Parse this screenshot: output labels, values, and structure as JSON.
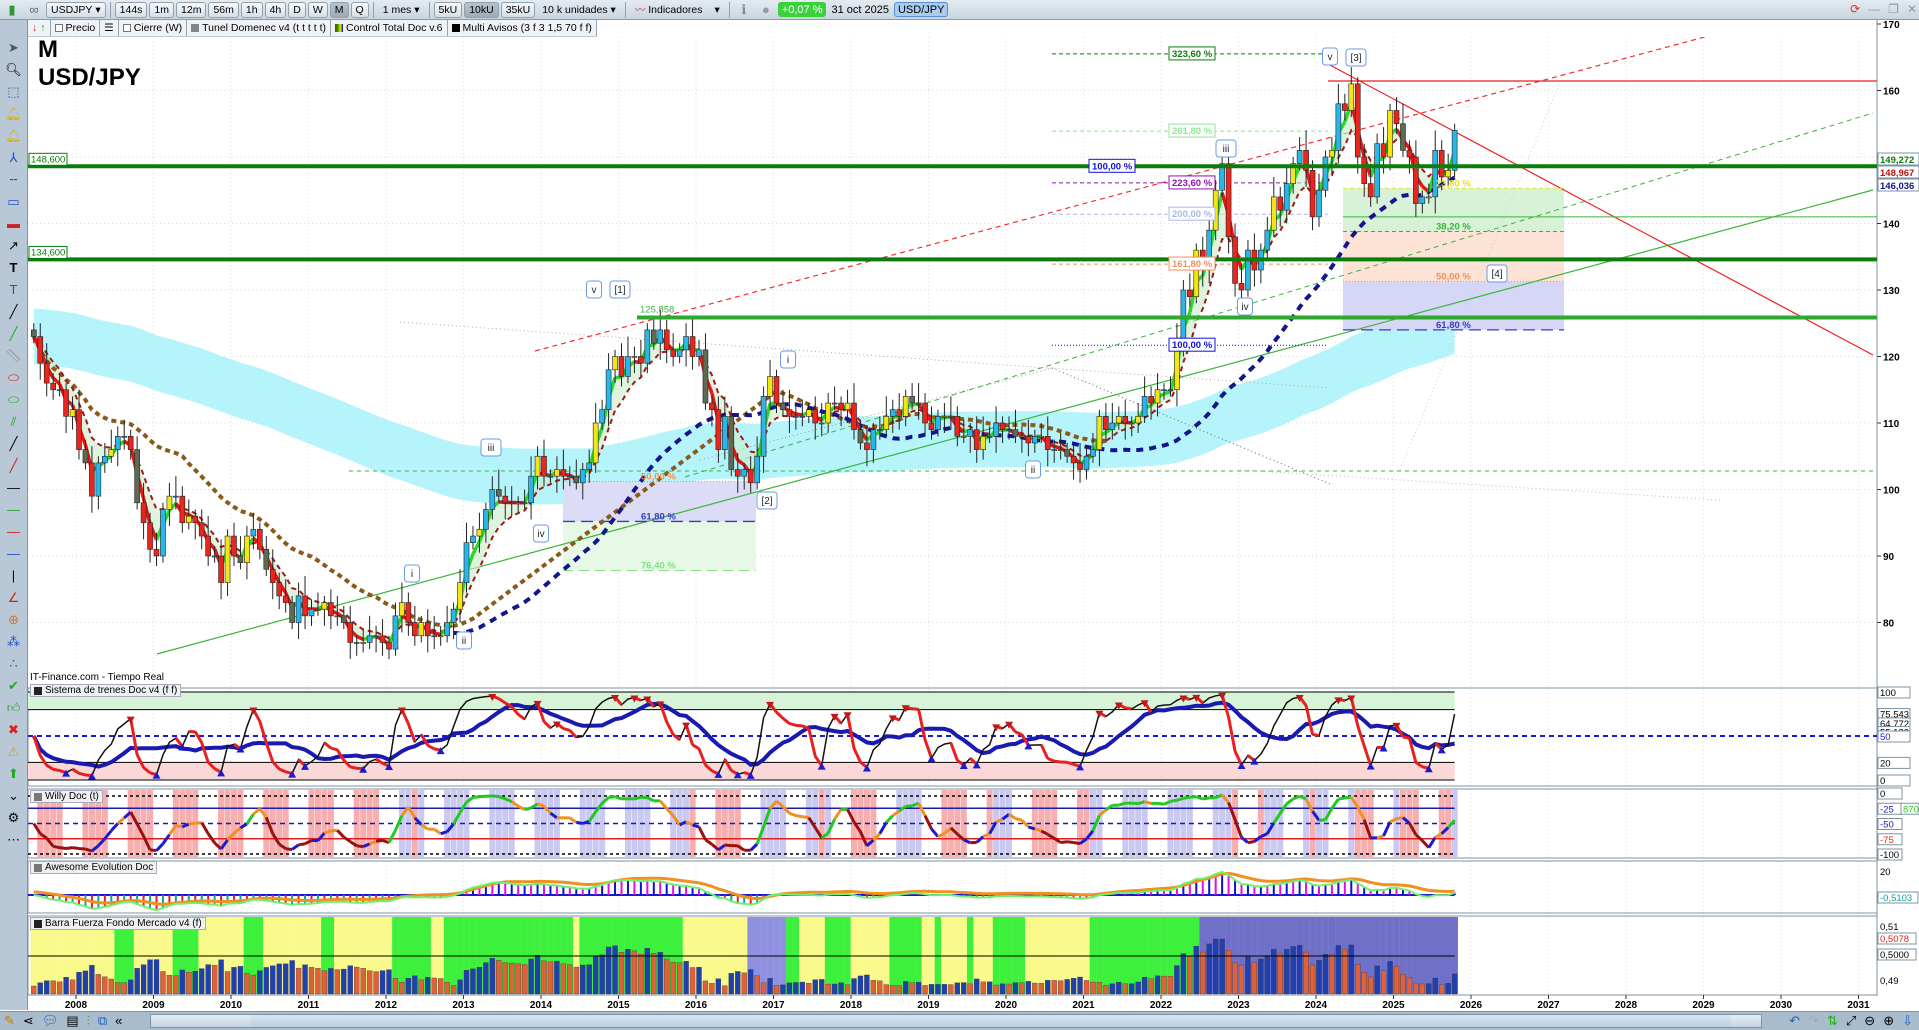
{
  "toolbar": {
    "symbol": "USDJPY",
    "timeframes": [
      "144s",
      "1m",
      "12m",
      "56m",
      "1h",
      "4h",
      "D",
      "W",
      "M",
      "Q"
    ],
    "active_timeframe": "M",
    "period": "1 mes",
    "units": [
      "5kU",
      "10kU",
      "35kU"
    ],
    "active_unit": "10kU",
    "units_select": "10 k unidades",
    "indicators_label": "Indicadores",
    "change": "+0,07 %",
    "date": "31 oct 2025",
    "pair_badge": "USD/JPY"
  },
  "legend": {
    "price": "Precio",
    "close": "Cierre (W)",
    "tunel": "Tunel Domenec v4 (t t t t t)",
    "control": "Control Total Doc v.6",
    "avisos": "Multi Avisos (3 f 3 1,5 70 f f)"
  },
  "chart_title": {
    "period": "M",
    "pair": "USD/JPY"
  },
  "source": "IT-Finance.com - Tiempo Real",
  "panes": {
    "p1": "Sistema de trenes Doc v4 (f f)",
    "p2": "Willy Doc (t)",
    "p3": "Awesome Evolution Doc",
    "p4": "Barra Fuerza Fondo Mercado v4 (f)"
  },
  "colors": {
    "up_a": "#29b6e8",
    "up_b": "#f5e60f",
    "down_a": "#e8261e",
    "down_b": "#5d6b55",
    "support": "#0a7d0a",
    "resistance": "#e81e1e",
    "navy": "#14148c"
  },
  "chart_data": {
    "type": "candlestick",
    "start": "2007-06",
    "closes": [
      123,
      119,
      116,
      115,
      115,
      111,
      112,
      106,
      104,
      99,
      104,
      105,
      106,
      108,
      108,
      106,
      98,
      95,
      91,
      90,
      97,
      99,
      99,
      95,
      96,
      95,
      93,
      90,
      90,
      86,
      93,
      90,
      89,
      93,
      94,
      91,
      88,
      86,
      84,
      83,
      80,
      84,
      81,
      82,
      82,
      83,
      81,
      81,
      80,
      77,
      77,
      77,
      78,
      78,
      77,
      76,
      81,
      83,
      80,
      78,
      80,
      78,
      78,
      78,
      80,
      82,
      86,
      92,
      93,
      94,
      97,
      100,
      99,
      98,
      98,
      98,
      98,
      102,
      105,
      102,
      102,
      103,
      102,
      102,
      101,
      103,
      104,
      110,
      112,
      118,
      120,
      117,
      120,
      120,
      119,
      124,
      122,
      124,
      121,
      120,
      121,
      123,
      120,
      121,
      113,
      112,
      106,
      111,
      103,
      102,
      103,
      101,
      105,
      114,
      117,
      113,
      112,
      111,
      111,
      111,
      112,
      110,
      110,
      113,
      113,
      112,
      113,
      109,
      107,
      106,
      109,
      109,
      111,
      112,
      111,
      114,
      113,
      113,
      110,
      109,
      111,
      111,
      111,
      108,
      108,
      109,
      106,
      108,
      108,
      110,
      109,
      109,
      108,
      108,
      107,
      108,
      108,
      106,
      106,
      106,
      105,
      104,
      103,
      105,
      106,
      111,
      109,
      110,
      111,
      110,
      110,
      111,
      114,
      113,
      115,
      115,
      115,
      122,
      130,
      129,
      136,
      133,
      139,
      145,
      149,
      138,
      131,
      130,
      136,
      133,
      136,
      139,
      144,
      142,
      146,
      149,
      151,
      148,
      141,
      145,
      150,
      151,
      158,
      157,
      161,
      150,
      146,
      144,
      152,
      150,
      157,
      155,
      151,
      150,
      143,
      144,
      144,
      151,
      147,
      148,
      154
    ],
    "years": [
      "2008",
      "2009",
      "2010",
      "2011",
      "2012",
      "2013",
      "2014",
      "2015",
      "2016",
      "2017",
      "2018",
      "2019",
      "2020",
      "2021",
      "2022",
      "2023",
      "2024",
      "2025",
      "2026",
      "2027",
      "2028",
      "2029",
      "2030",
      "2031"
    ],
    "price_ticks": [
      "170",
      "160",
      "150",
      "140",
      "130",
      "120",
      "110",
      "100",
      "90",
      "80"
    ],
    "price_tick_values": [
      170,
      160,
      150,
      140,
      130,
      120,
      110,
      100,
      90,
      80
    ],
    "levels": [
      {
        "label": "148,600",
        "price": 148.6
      },
      {
        "label": "134,600",
        "price": 134.6
      },
      {
        "label": "125,858",
        "price": 125.858
      }
    ],
    "last_values": [
      {
        "label": "149,272",
        "color": "#0a7d0a"
      },
      {
        "label": "148,967",
        "color": "#c01010"
      },
      {
        "label": "146,036",
        "color": "#14148c"
      }
    ],
    "fib_labels": [
      {
        "label": "323,60 %",
        "price": 165.5,
        "color": "#0a7d0a"
      },
      {
        "label": "261,80 %",
        "price": 153.9,
        "color": "#8ee88e"
      },
      {
        "label": "100,00 %",
        "price": 148.6,
        "color": "#1010e0"
      },
      {
        "label": "223,60 %",
        "price": 146.1,
        "color": "#9010b0"
      },
      {
        "label": "200,00 %",
        "price": 141.4,
        "color": "#a8b8f0"
      },
      {
        "label": "161,80 %",
        "price": 133.9,
        "color": "#f09060"
      },
      {
        "label": "100,00 %",
        "price": 121.7,
        "color": "#1010e0"
      }
    ],
    "retracements_right": [
      {
        "label": "23,60 %",
        "price": 145.3,
        "color": "#e8e020"
      },
      {
        "label": "38,20 %",
        "price": 138.8,
        "color": "#3cb43c"
      },
      {
        "label": "50,00 %",
        "price": 131.3,
        "color": "#f09050"
      },
      {
        "label": "61,80 %",
        "price": 124.0,
        "color": "#3040c0"
      }
    ],
    "retracements_left": [
      {
        "label": "50,00 %",
        "price": 101.2,
        "color": "#f09050"
      },
      {
        "label": "61,80 %",
        "price": 95.2,
        "color": "#3040c0"
      },
      {
        "label": "76,40 %",
        "price": 87.8,
        "color": "#80e080"
      }
    ],
    "waves": [
      "v",
      "[1]",
      "iii",
      "iv",
      "i",
      "ii",
      "i",
      "[2]",
      "ii",
      "iii",
      "iv",
      "v",
      "[3]",
      "[4]"
    ],
    "p1_axis": [
      "100",
      "75,543",
      "64,772",
      "55,132",
      "50",
      "20",
      "0"
    ],
    "p2_axis": [
      "0",
      "-25",
      "870",
      "-50",
      "-75",
      "-100"
    ],
    "p3_axis": [
      "20",
      "-0,5103"
    ],
    "p4_axis": [
      "0,51",
      "0,5078",
      "0,5000",
      "0,49"
    ]
  }
}
